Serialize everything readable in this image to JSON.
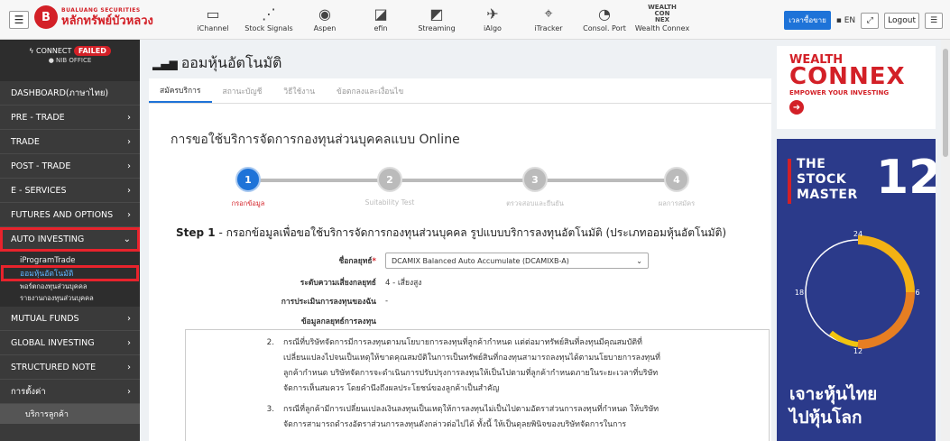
{
  "header": {
    "logo_en": "BUALUANG SECURITIES",
    "logo_th": "หลักทรัพย์บัวหลวง",
    "apps": [
      {
        "label": "iChannel",
        "icon": "ichannel-icon"
      },
      {
        "label": "Stock Signals",
        "icon": "stock-signals-icon"
      },
      {
        "label": "Aspen",
        "icon": "aspen-icon"
      },
      {
        "label": "efin",
        "icon": "efin-icon"
      },
      {
        "label": "Streaming",
        "icon": "streaming-icon"
      },
      {
        "label": "iAlgo",
        "icon": "ialgo-icon"
      },
      {
        "label": "iTracker",
        "icon": "itracker-icon"
      },
      {
        "label": "Consol. Port",
        "icon": "consol-port-icon"
      },
      {
        "label": "Wealth Connex",
        "icon": "wealth-connex-icon",
        "logo_text": [
          "WEALTH",
          "CON",
          "NEX"
        ]
      }
    ],
    "time_button": "เวลาซื้อขาย",
    "lang": "EN",
    "logout": "Logout"
  },
  "sidebar": {
    "connect_label": "CONNECT",
    "connect_status": "FAILED",
    "office": "NIB OFFICE",
    "items_top": [
      {
        "label": "DASHBOARD(ภาษาไทย)",
        "chev": ""
      },
      {
        "label": "PRE - TRADE",
        "chev": "›"
      },
      {
        "label": "TRADE",
        "chev": "›"
      },
      {
        "label": "POST - TRADE",
        "chev": "›"
      },
      {
        "label": "E - SERVICES",
        "chev": "›"
      },
      {
        "label": "FUTURES AND OPTIONS",
        "chev": "›"
      }
    ],
    "auto_investing": {
      "label": "AUTO INVESTING",
      "chev": "⌄"
    },
    "sub_items": [
      "iProgramTrade",
      "ออมหุ้นอัตโนมัติ",
      "พอร์ตกองทุนส่วนบุคคล",
      "รายงานกองทุนส่วนบุคคล"
    ],
    "items_bottom": [
      {
        "label": "MUTUAL FUNDS",
        "chev": "›"
      },
      {
        "label": "GLOBAL INVESTING",
        "chev": "›"
      },
      {
        "label": "STRUCTURED NOTE",
        "chev": "›"
      },
      {
        "label": "การตั้งค่า",
        "chev": "›"
      }
    ],
    "bottom_item": "บริการลูกค้า"
  },
  "annotations": {
    "one": "1",
    "two": "2"
  },
  "main": {
    "title": "ออมหุ้นอัตโนมัติ",
    "tabs": [
      "สมัครบริการ",
      "สถานะบัญชี",
      "วิธีใช้งาน",
      "ข้อตกลงและเงื่อนไข"
    ],
    "form_title": "การขอใช้บริการจัดการกองทุนส่วนบุคคลแบบ Online",
    "steps": [
      {
        "num": "1",
        "label": "กรอกข้อมูล"
      },
      {
        "num": "2",
        "label": "Suitability Test"
      },
      {
        "num": "3",
        "label": "ตรวจสอบและยืนยัน"
      },
      {
        "num": "4",
        "label": "ผลการสมัคร"
      }
    ],
    "step1_prefix": "Step 1",
    "step1_text": " - กรอกข้อมูลเพื่อขอใช้บริการจัดการกองทุนส่วนบุคคล รูปแบบบริการลงทุนอัตโนมัติ (ประเภทออมหุ้นอัตโนมัติ)",
    "fields": {
      "strategy_label": "ชื่อกลยุทธ์",
      "strategy_required": "*",
      "strategy_value": "DCAMIX Balanced Auto Accumulate (DCAMIXB-A)",
      "risk_label": "ระดับความเสี่ยงกลยุทธ์",
      "risk_value": "4 - เสี่ยงสูง",
      "forecast_label": "การประเมินการลงทุนของฉัน",
      "forecast_value": "-",
      "info_label": "ข้อมูลกลยุทธ์การลงทุน"
    },
    "terms": [
      {
        "n": "2.",
        "t": "กรณีที่บริษัทจัดการมีการลงทุนตามนโยบายการลงทุนที่ลูกค้ากำหนด แต่ต่อมาทรัพย์สินที่ลงทุนมีคุณสมบัติที่เปลี่ยนแปลงไปจนเป็นเหตุให้ขาดคุณสมบัติในการเป็นทรัพย์สินที่กองทุนสามารถลงทุนได้ตามนโยบายการลงทุนที่ลูกค้ากำหนด บริษัทจัดการจะดำเนินการปรับปรุงการลงทุนให้เป็นไปตามที่ลูกค้ากำหนดภายในระยะเวลาที่บริษัทจัดการเห็นสมควร โดยคำนึงถึงผลประโยชน์ของลูกค้าเป็นสำคัญ"
      },
      {
        "n": "3.",
        "t": "กรณีที่ลูกค้ามีการเปลี่ยนแปลงเงินลงทุนเป็นเหตุให้การลงทุนไม่เป็นไปตามอัตราส่วนการลงทุนที่กำหนด ให้บริษัทจัดการสามารถดำรงอัตราส่วนการลงทุนดังกล่าวต่อไปได้ ทั้งนี้ ให้เป็นดุลยพินิจของบริษัทจัดการในการ"
      }
    ]
  },
  "ads": {
    "wealth": "WEALTH",
    "connex": "CONNEX",
    "empower": "EMPOWER YOUR INVESTING",
    "stock_master_lines": [
      "THE",
      "STOCK",
      "MASTER"
    ],
    "stock_master_num": "12",
    "clock_labels": [
      "24",
      "6",
      "18",
      "12"
    ],
    "thai_lines": [
      "เจาะหุ้นไทย",
      "ไปหุ้นโลก"
    ]
  },
  "colors": {
    "brand_red": "#d32027",
    "accent_blue": "#1e73d8",
    "sidebar": "#3a3a3a"
  }
}
